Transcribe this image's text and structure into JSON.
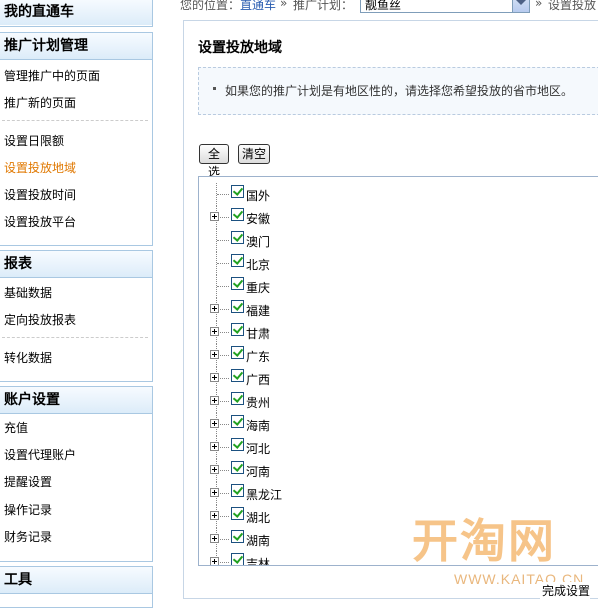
{
  "sidebar": {
    "my_train": "我的直通车",
    "plan_section": {
      "title": "推广计划管理",
      "items": [
        "管理推广中的页面",
        "推广新的页面",
        "设置日限额",
        "设置投放地域",
        "设置投放时间",
        "设置投放平台"
      ]
    },
    "report_section": {
      "title": "报表",
      "items": [
        "基础数据",
        "定向投放报表",
        "转化数据"
      ]
    },
    "account_section": {
      "title": "账户设置",
      "items": [
        "充值",
        "设置代理账户",
        "提醒设置",
        "操作记录",
        "财务记录"
      ]
    },
    "tools_section": {
      "title": "工具"
    }
  },
  "topbar": {
    "location_prefix": "您的位置：",
    "location_link": "直通车",
    "sep1": "»",
    "plan_label": "推广计划：",
    "plan_value": "靓鱼丝",
    "sep2": "»",
    "current": "设置投放"
  },
  "main": {
    "title": "设置投放地域",
    "notice": "如果您的推广计划是有地区性的，请选择您希望投放的省市地区。",
    "select_all": "全选",
    "clear": "清空",
    "regions": [
      {
        "name": "国外",
        "expandable": false,
        "checked": true
      },
      {
        "name": "安徽",
        "expandable": true,
        "checked": true
      },
      {
        "name": "澳门",
        "expandable": false,
        "checked": true
      },
      {
        "name": "北京",
        "expandable": false,
        "checked": true
      },
      {
        "name": "重庆",
        "expandable": false,
        "checked": true
      },
      {
        "name": "福建",
        "expandable": true,
        "checked": true
      },
      {
        "name": "甘肃",
        "expandable": true,
        "checked": true
      },
      {
        "name": "广东",
        "expandable": true,
        "checked": true
      },
      {
        "name": "广西",
        "expandable": true,
        "checked": true
      },
      {
        "name": "贵州",
        "expandable": true,
        "checked": true
      },
      {
        "name": "海南",
        "expandable": true,
        "checked": true
      },
      {
        "name": "河北",
        "expandable": true,
        "checked": true
      },
      {
        "name": "河南",
        "expandable": true,
        "checked": true
      },
      {
        "name": "黑龙江",
        "expandable": true,
        "checked": true
      },
      {
        "name": "湖北",
        "expandable": true,
        "checked": true
      },
      {
        "name": "湖南",
        "expandable": true,
        "checked": true
      },
      {
        "name": "吉林",
        "expandable": true,
        "checked": true
      }
    ],
    "finish": "完成设置"
  },
  "watermark": {
    "logo": "开淘网",
    "url": "WWW.KAITAO.CN"
  }
}
